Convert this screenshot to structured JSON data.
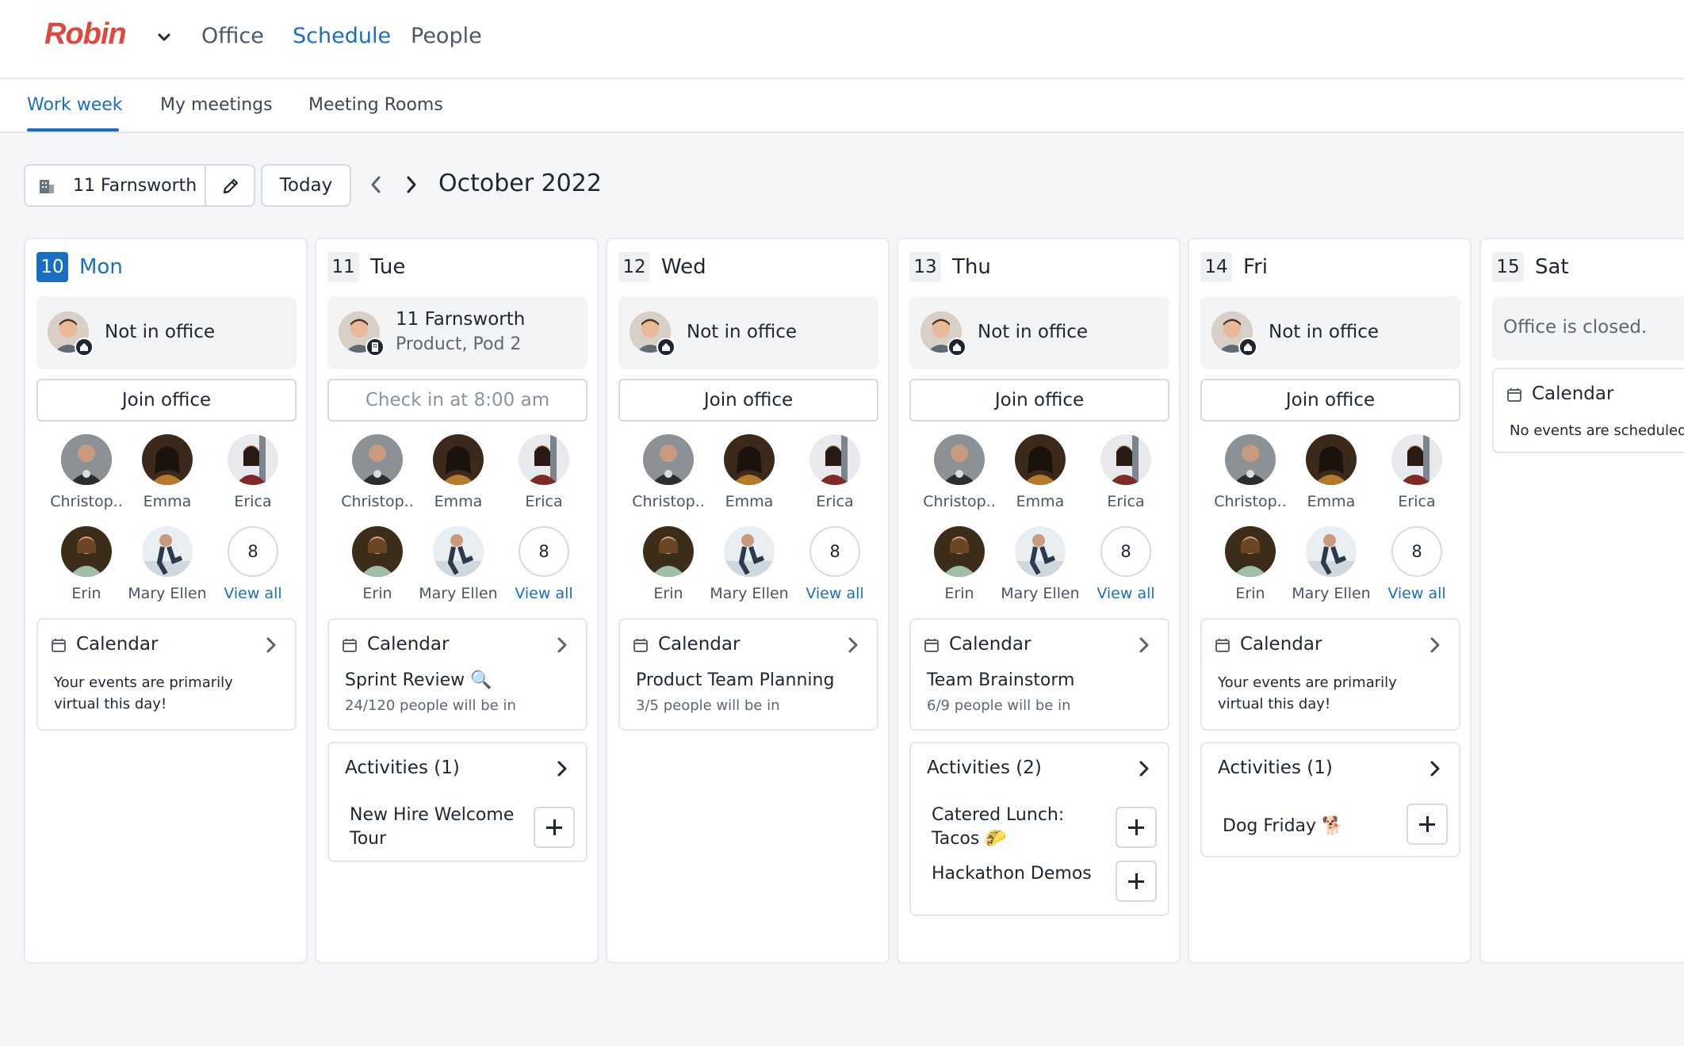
{
  "app": {
    "logo": "Robin"
  },
  "topnav": {
    "items": [
      "Office",
      "Schedule",
      "People"
    ],
    "active": "Schedule"
  },
  "subtabs": {
    "items": [
      "Work week",
      "My meetings",
      "Meeting Rooms"
    ],
    "active": "Work week"
  },
  "toolbar": {
    "location": "11 Farnsworth",
    "today_label": "Today",
    "month": "October 2022"
  },
  "colors": {
    "brand": "#e2453c",
    "accent": "#1a6ec1"
  },
  "days": [
    {
      "num": "10",
      "name": "Mon",
      "today": true,
      "status": "Not in office",
      "status_icon": "home-icon",
      "join": "Join office",
      "people": [
        "Christop..",
        "Emma",
        "Erica",
        "Erin",
        "Mary Ellen"
      ],
      "more_count": "8",
      "view_all": "View all",
      "calendar": {
        "title": "Calendar",
        "note": "Your events are primarily virtual this day!"
      }
    },
    {
      "num": "11",
      "name": "Tue",
      "today": false,
      "status": "11 Farnsworth",
      "status_sub": "Product, Pod 2",
      "status_icon": "building-icon",
      "join": "Check in at 8:00 am",
      "people": [
        "Christop..",
        "Emma",
        "Erica",
        "Erin",
        "Mary Ellen"
      ],
      "more_count": "8",
      "view_all": "View all",
      "calendar": {
        "title": "Calendar",
        "event": "Sprint Review 🔍",
        "event_sub": "24/120 people will be in"
      },
      "activities": {
        "title": "Activities (1)",
        "items": [
          "New Hire Welcome Tour"
        ]
      }
    },
    {
      "num": "12",
      "name": "Wed",
      "today": false,
      "status": "Not in office",
      "status_icon": "home-icon",
      "join": "Join office",
      "people": [
        "Christop..",
        "Emma",
        "Erica",
        "Erin",
        "Mary Ellen"
      ],
      "more_count": "8",
      "view_all": "View all",
      "calendar": {
        "title": "Calendar",
        "event": "Product Team Planning",
        "event_sub": "3/5 people will be in"
      }
    },
    {
      "num": "13",
      "name": "Thu",
      "today": false,
      "status": "Not in office",
      "status_icon": "home-icon",
      "join": "Join office",
      "people": [
        "Christop..",
        "Emma",
        "Erica",
        "Erin",
        "Mary Ellen"
      ],
      "more_count": "8",
      "view_all": "View all",
      "calendar": {
        "title": "Calendar",
        "event": "Team Brainstorm",
        "event_sub": "6/9 people will be in"
      },
      "activities": {
        "title": "Activities (2)",
        "items": [
          "Catered Lunch: Tacos 🌮",
          "Hackathon Demos"
        ]
      }
    },
    {
      "num": "14",
      "name": "Fri",
      "today": false,
      "status": "Not in office",
      "status_icon": "home-icon",
      "join": "Join office",
      "people": [
        "Christop..",
        "Emma",
        "Erica",
        "Erin",
        "Mary Ellen"
      ],
      "more_count": "8",
      "view_all": "View all",
      "calendar": {
        "title": "Calendar",
        "note": "Your events are primarily virtual this day!"
      },
      "activities": {
        "title": "Activities (1)",
        "items": [
          "Dog Friday 🐕"
        ]
      }
    },
    {
      "num": "15",
      "name": "Sat",
      "today": false,
      "closed": "Office is closed.",
      "calendar": {
        "title": "Calendar",
        "note": "No events are scheduled"
      }
    }
  ]
}
